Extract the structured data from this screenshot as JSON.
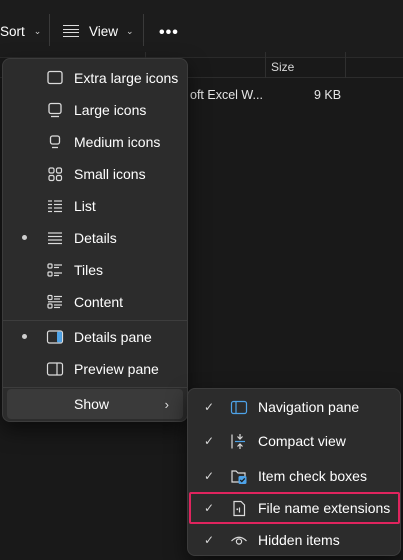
{
  "toolbar": {
    "sort_label": "Sort",
    "view_label": "View",
    "more_label": "•••"
  },
  "file_list": {
    "size_header": "Size",
    "file_type": "oft Excel W...",
    "file_size": "9 KB"
  },
  "view_menu": {
    "items": [
      {
        "label": "Extra large icons",
        "selected": false
      },
      {
        "label": "Large icons",
        "selected": false
      },
      {
        "label": "Medium icons",
        "selected": false
      },
      {
        "label": "Small icons",
        "selected": false
      },
      {
        "label": "List",
        "selected": false
      },
      {
        "label": "Details",
        "selected": true
      },
      {
        "label": "Tiles",
        "selected": false
      },
      {
        "label": "Content",
        "selected": false
      }
    ],
    "panes": [
      {
        "label": "Details pane",
        "selected": true
      },
      {
        "label": "Preview pane",
        "selected": false
      }
    ],
    "show_label": "Show"
  },
  "show_menu": {
    "items": [
      {
        "label": "Navigation pane",
        "checked": true,
        "icon": "navigation-pane-icon"
      },
      {
        "label": "Compact view",
        "checked": true,
        "icon": "compact-view-icon"
      },
      {
        "label": "Item check boxes",
        "checked": true,
        "icon": "item-check-boxes-icon"
      },
      {
        "label": "File name extensions",
        "checked": true,
        "icon": "file-extension-icon",
        "highlighted": true
      },
      {
        "label": "Hidden items",
        "checked": true,
        "icon": "eye-icon"
      }
    ]
  },
  "colors": {
    "accent": "#4ea3e8",
    "highlight": "#e0245e",
    "menu_bg": "#2c2c2c"
  }
}
